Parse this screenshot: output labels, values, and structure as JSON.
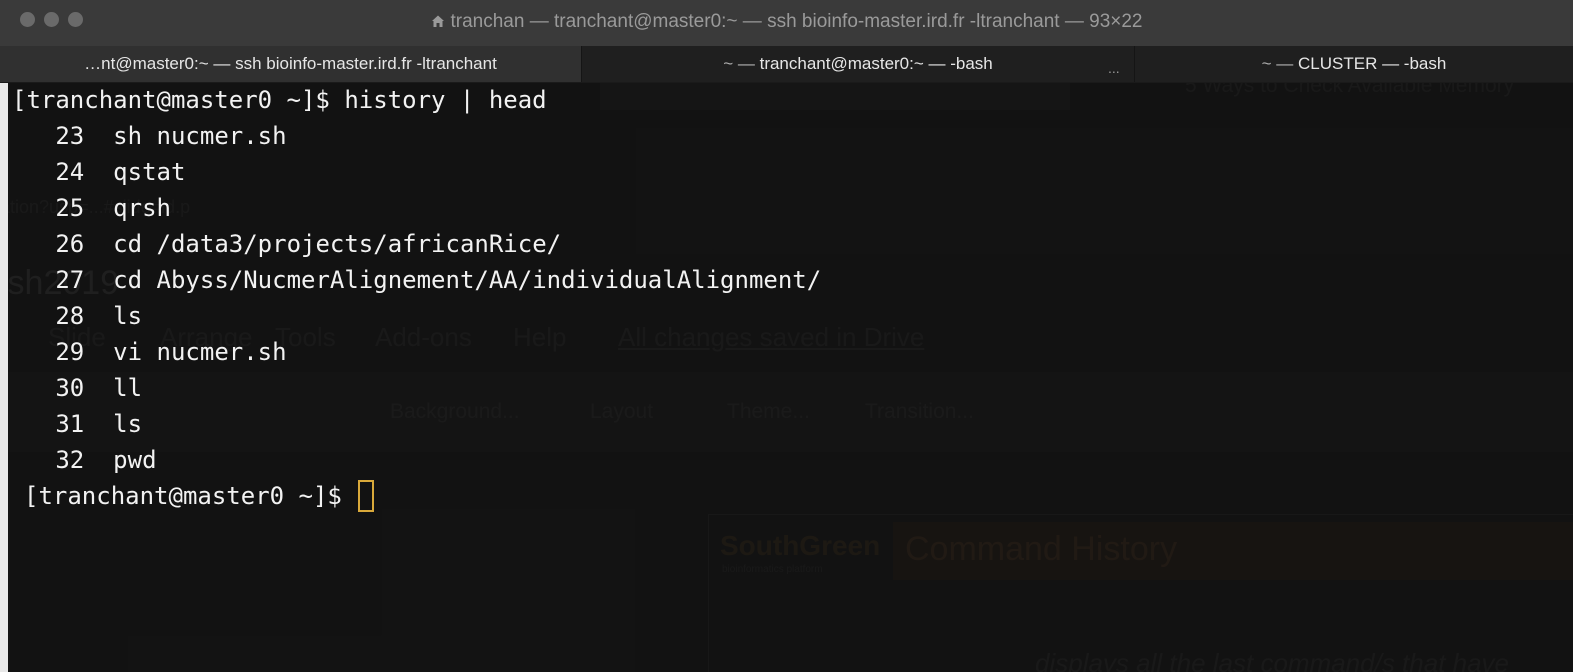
{
  "window": {
    "title": "tranchan — tranchant@master0:~ — ssh bioinfo-master.ird.fr -ltranchant — 93×22"
  },
  "tabs": [
    {
      "label": "…nt@master0:~ — ssh bioinfo-master.ird.fr -ltranchant",
      "active": true
    },
    {
      "label_dim": "~ — ",
      "label": "tranchant@master0:~ — -bash",
      "active": false
    },
    {
      "label_dim": "~ — ",
      "label": "CLUSTER — -bash",
      "active": false
    }
  ],
  "tab_overflow": "...",
  "terminal": {
    "prompt_mark": "[",
    "command_line": "[tranchant@master0 ~]$ history | head",
    "history": [
      {
        "num": "23",
        "cmd": "sh nucmer.sh"
      },
      {
        "num": "24",
        "cmd": "qstat"
      },
      {
        "num": "25",
        "cmd": "qrsh"
      },
      {
        "num": "26",
        "cmd": "cd /data3/projects/africanRice/"
      },
      {
        "num": "27",
        "cmd": "cd Abyss/NucmerAlignement/AA/individualAlignment/"
      },
      {
        "num": "28",
        "cmd": "ls"
      },
      {
        "num": "29",
        "cmd": "vi nucmer.sh"
      },
      {
        "num": "30",
        "cmd": "ll"
      },
      {
        "num": "31",
        "cmd": "ls"
      },
      {
        "num": "32",
        "cmd": "pwd"
      }
    ],
    "final_prompt": "[tranchant@master0 ~]$ "
  },
  "background_app": {
    "url_fragment": "ation?usp=...#slide=id.p",
    "doc_title": "ish2019",
    "menu_items": [
      "t",
      "Slide",
      "Arrange",
      "Tools",
      "Add-ons",
      "Help"
    ],
    "save_status": "All changes saved in Drive",
    "toolbar_items": [
      "Background...",
      "Layout",
      "Theme...",
      "Transition..."
    ],
    "slide_logo": "SouthGreen",
    "slide_logo_sub": "bioinformatics platform",
    "slide_heading": "Command History",
    "tab_hint": "5 Ways to Check Available Memory",
    "slide_body": "displays all the last command/s that have"
  },
  "colors": {
    "cursor": "#d9a93a",
    "terminal_text": "#f2f2f2",
    "titlebar": "#3a3a3a"
  }
}
